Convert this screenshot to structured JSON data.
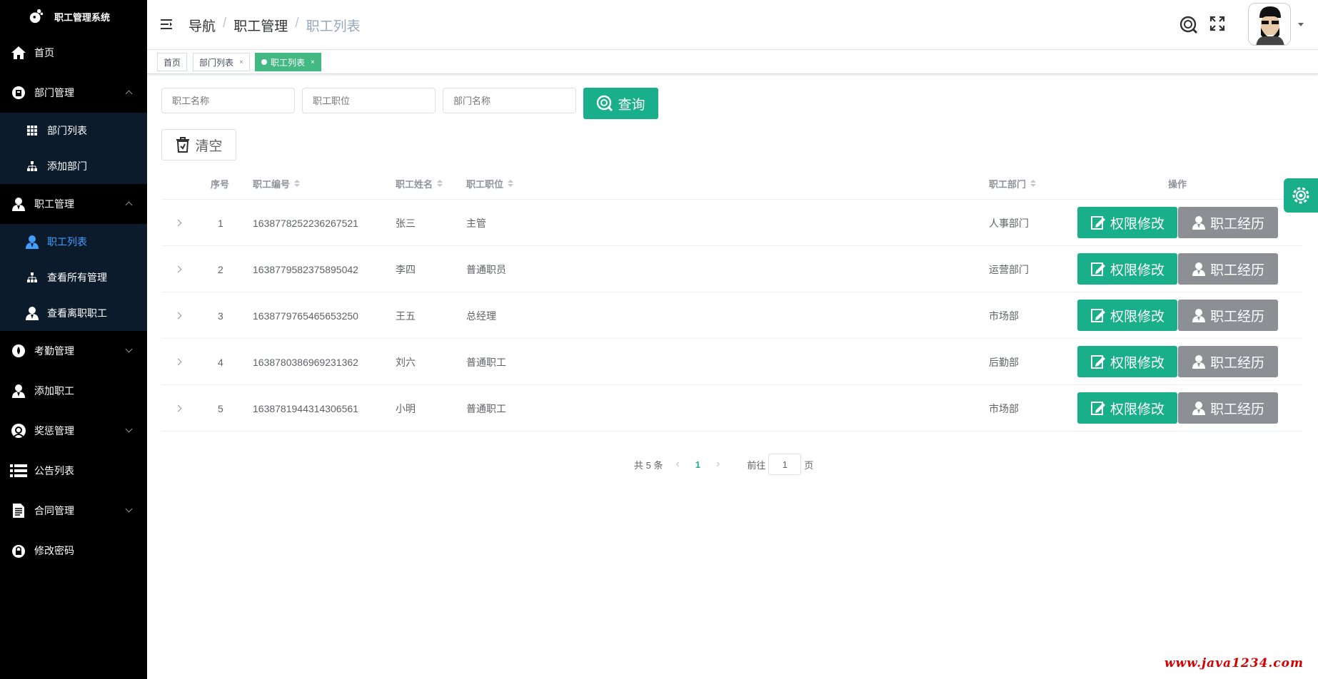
{
  "app": {
    "title": "职工管理系统"
  },
  "sidebar": {
    "items": [
      {
        "label": "首页",
        "icon": "home-icon"
      },
      {
        "label": "部门管理",
        "icon": "building-icon",
        "expanded": true,
        "children": [
          {
            "label": "部门列表",
            "icon": "grid-icon"
          },
          {
            "label": "添加部门",
            "icon": "org-icon"
          }
        ]
      },
      {
        "label": "职工管理",
        "icon": "user-icon",
        "expanded": true,
        "children": [
          {
            "label": "职工列表",
            "icon": "user-icon",
            "active": true
          },
          {
            "label": "查看所有管理",
            "icon": "org-icon"
          },
          {
            "label": "查看离职职工",
            "icon": "user-icon"
          }
        ]
      },
      {
        "label": "考勤管理",
        "icon": "drop-icon"
      },
      {
        "label": "添加职工",
        "icon": "user-icon"
      },
      {
        "label": "奖惩管理",
        "icon": "face-icon"
      },
      {
        "label": "公告列表",
        "icon": "list-icon"
      },
      {
        "label": "合同管理",
        "icon": "doc-icon"
      },
      {
        "label": "修改密码",
        "icon": "lock-icon"
      }
    ]
  },
  "header": {
    "breadcrumb": [
      "导航",
      "职工管理",
      "职工列表"
    ]
  },
  "tags": [
    {
      "label": "首页"
    },
    {
      "label": "部门列表",
      "close": "×"
    },
    {
      "label": "职工列表",
      "close": "×",
      "active": true
    }
  ],
  "filters": {
    "name_placeholder": "职工名称",
    "position_placeholder": "职工职位",
    "dept_placeholder": "部门名称",
    "search_label": "查询",
    "clear_label": "清空"
  },
  "table": {
    "headers": {
      "index": "序号",
      "id": "职工编号",
      "name": "职工姓名",
      "position": "职工职位",
      "dept": "职工部门",
      "ops": "操作"
    },
    "edit_label": "权限修改",
    "exp_label": "职工经历",
    "rows": [
      {
        "index": "1",
        "id": "1638778252236267521",
        "name": "张三",
        "position": "主管",
        "dept": "人事部门"
      },
      {
        "index": "2",
        "id": "1638779582375895042",
        "name": "李四",
        "position": "普通职员",
        "dept": "运营部门"
      },
      {
        "index": "3",
        "id": "1638779765465653250",
        "name": "王五",
        "position": "总经理",
        "dept": "市场部"
      },
      {
        "index": "4",
        "id": "1638780386969231362",
        "name": "刘六",
        "position": "普通职工",
        "dept": "后勤部"
      },
      {
        "index": "5",
        "id": "1638781944314306561",
        "name": "小明",
        "position": "普通职工",
        "dept": "市场部"
      }
    ]
  },
  "pagination": {
    "total": "共 5 条",
    "current": "1",
    "goto_prefix": "前往",
    "goto_value": "1",
    "goto_suffix": "页"
  },
  "watermark": "www.java1234.com",
  "colors": {
    "primary": "#1aaf8b",
    "gray_button": "#8c8f94",
    "sidebar_bg": "#000000",
    "active_link": "#409eff"
  }
}
